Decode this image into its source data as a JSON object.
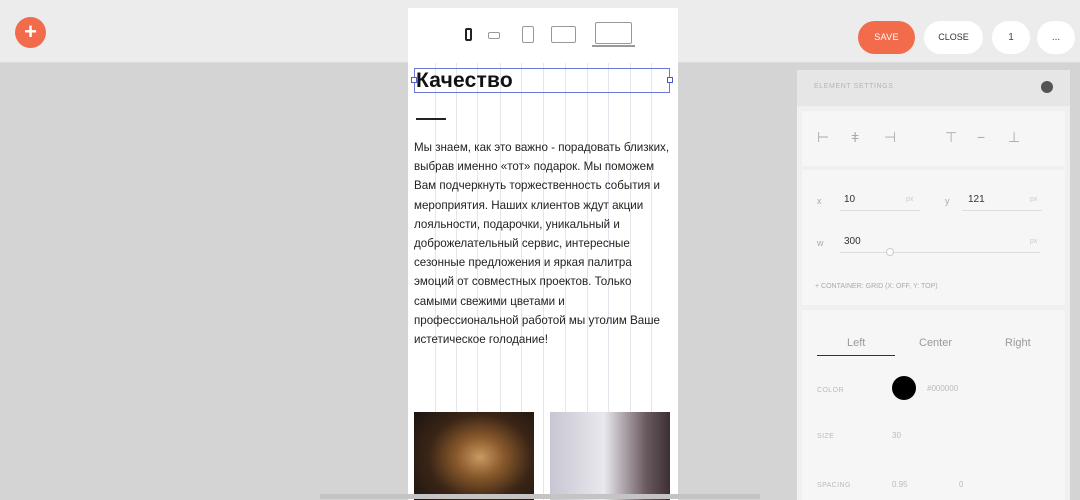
{
  "toolbar": {
    "add_label": "+",
    "save_label": "SAVE",
    "close_label": "CLOSE",
    "more_label": "...",
    "step_label": "1"
  },
  "devices": [
    "phone-portrait",
    "phone-landscape",
    "tablet-portrait",
    "tablet-landscape",
    "desktop"
  ],
  "canvas": {
    "title": "Качество",
    "paragraph": "Мы знаем, как это важно - порадовать близких, выбрав именно «тот» подарок. Мы поможем Вам подчеркнуть торжественность события и мероприятия. Наших клиентов ждут акции лояльности, подарочки, уникальный и доброжелательный сервис, интересные сезонные предложения и яркая палитра эмоций от совместных проектов. Только самыми свежими цветами и профессиональной работой мы утолим Ваше истетическое голодание!"
  },
  "panel": {
    "title": "ELEMENT SETTINGS",
    "x_label": "x",
    "x_value": "10",
    "y_label": "y",
    "y_value": "121",
    "w_label": "w",
    "w_value": "300",
    "unit": "px",
    "note": "+ CONTAINER: GRID (X: OFF, Y: TOP)",
    "tabs": [
      "Left",
      "Center",
      "Right"
    ],
    "color_label": "COLOR",
    "color_value": "#000000",
    "size_label": "SIZE",
    "size_value": "30",
    "spacing_label": "SPACING",
    "spacing_value": "0.95",
    "spacing_value2": "0"
  },
  "colors": {
    "accent": "#f26b4b",
    "selection": "#6b78d8"
  }
}
